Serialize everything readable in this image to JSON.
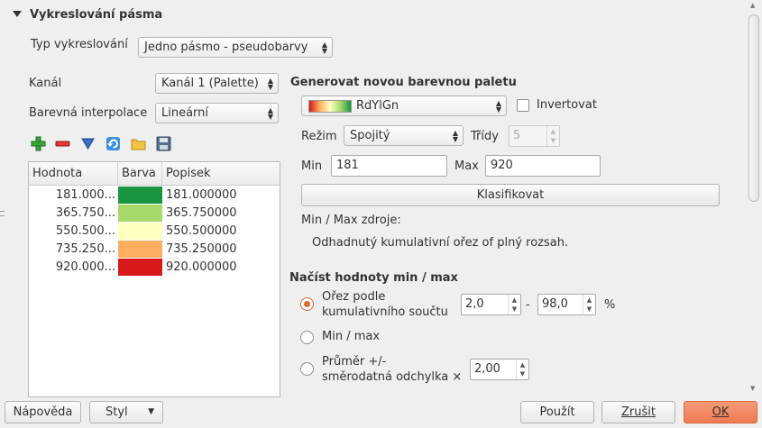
{
  "section": {
    "title": "Vykreslování pásma"
  },
  "render_type": {
    "label": "Typ vykreslování",
    "value": "Jedno pásmo - pseudobarvy"
  },
  "channel": {
    "label": "Kanál",
    "value": "Kanál 1 (Palette)"
  },
  "interpolation": {
    "label": "Barevná interpolace",
    "value": "Lineární"
  },
  "table": {
    "headers": [
      "Hodnota",
      "Barva",
      "Popisek"
    ],
    "rows": [
      {
        "value": "181.000...",
        "color": "#1a9641",
        "label": "181.000000"
      },
      {
        "value": "365.750...",
        "color": "#a6d96a",
        "label": "365.750000"
      },
      {
        "value": "550.500...",
        "color": "#ffffc0",
        "label": "550.500000"
      },
      {
        "value": "735.250...",
        "color": "#fdae61",
        "label": "735.250000"
      },
      {
        "value": "920.000...",
        "color": "#d7191c",
        "label": "920.000000"
      }
    ]
  },
  "palette": {
    "heading": "Generovat novou barevnou paletu",
    "ramp_name": "RdYlGn",
    "invert_label": "Invertovat",
    "mode_label": "Režim",
    "mode_value": "Spojitý",
    "classes_label": "Třídy",
    "classes_value": "5",
    "min_label": "Min",
    "min_value": "181",
    "max_label": "Max",
    "max_value": "920",
    "classify_label": "Klasifikovat",
    "source_label": "Min / Max zdroje:",
    "source_desc": "Odhadnutý kumulativní ořez of plný rozsah."
  },
  "minmax": {
    "heading": "Načíst hodnoty min / max",
    "opt_cumulative_1": "Ořez podle",
    "opt_cumulative_2": "kumulativního součtu",
    "cum_low": "2,0",
    "cum_dash": "-",
    "cum_high": "98,0",
    "cum_unit": "%",
    "opt_minmax": "Min / max",
    "opt_stddev_1": "Průměr +/-",
    "opt_stddev_2": "směrodatná odchylka ×",
    "stddev_value": "2,00"
  },
  "footer": {
    "help": "Nápověda",
    "style": "Styl",
    "apply": "Použít",
    "cancel": "Zrušit",
    "ok": "OK"
  },
  "colors": {
    "accent": "#e0662f",
    "ok_button": "#ef7a50"
  }
}
